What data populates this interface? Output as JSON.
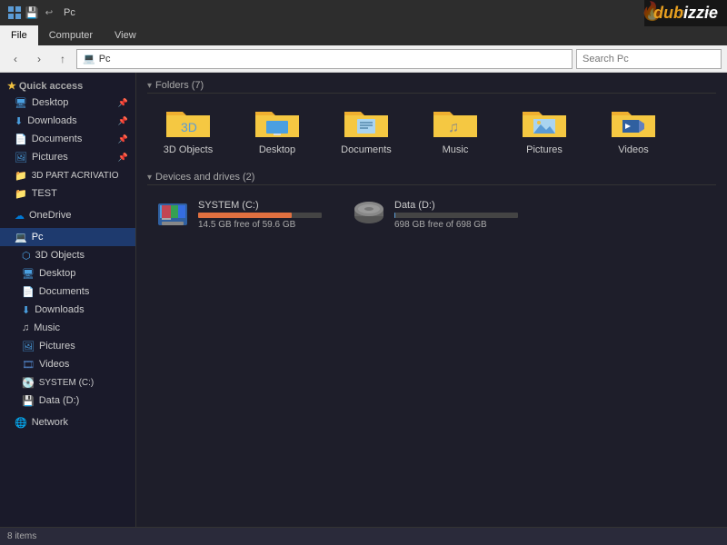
{
  "titlebar": {
    "title": "Pc",
    "minimize_label": "—",
    "maximize_label": "□",
    "close_label": "✕"
  },
  "ribbon": {
    "tabs": [
      "File",
      "Computer",
      "View"
    ],
    "active_tab": "File"
  },
  "address_bar": {
    "back_btn": "‹",
    "forward_btn": "›",
    "up_btn": "↑",
    "path_icon": "💻",
    "path": "Pc",
    "search_placeholder": "Search Pc"
  },
  "sidebar": {
    "quick_access_label": "Quick access",
    "items": [
      {
        "id": "desktop-qa",
        "label": "Desktop",
        "icon": "desktop",
        "pinned": true
      },
      {
        "id": "downloads-qa",
        "label": "Downloads",
        "icon": "download",
        "pinned": true
      },
      {
        "id": "documents-qa",
        "label": "Documents",
        "icon": "docs",
        "pinned": true
      },
      {
        "id": "pictures-qa",
        "label": "Pictures",
        "icon": "pics",
        "pinned": true
      },
      {
        "id": "3dpart",
        "label": "3D PART ACRIVATIO",
        "icon": "folder"
      },
      {
        "id": "test",
        "label": "TEST",
        "icon": "folder"
      },
      {
        "id": "onedrive",
        "label": "OneDrive",
        "icon": "onedrive"
      },
      {
        "id": "pc",
        "label": "Pc",
        "icon": "pc",
        "active": true
      },
      {
        "id": "3dobjects-pc",
        "label": "3D Objects",
        "icon": "folder",
        "indent": 1
      },
      {
        "id": "desktop-pc",
        "label": "Desktop",
        "icon": "desktop",
        "indent": 1
      },
      {
        "id": "documents-pc",
        "label": "Documents",
        "icon": "docs",
        "indent": 1
      },
      {
        "id": "downloads-pc",
        "label": "Downloads",
        "icon": "download",
        "indent": 1
      },
      {
        "id": "music-pc",
        "label": "Music",
        "icon": "music",
        "indent": 1
      },
      {
        "id": "pictures-pc",
        "label": "Pictures",
        "icon": "pics",
        "indent": 1
      },
      {
        "id": "videos-pc",
        "label": "Videos",
        "icon": "video",
        "indent": 1
      },
      {
        "id": "systemc",
        "label": "SYSTEM (C:)",
        "icon": "drive-c",
        "indent": 1
      },
      {
        "id": "datad",
        "label": "Data (D:)",
        "icon": "drive-d",
        "indent": 1
      },
      {
        "id": "network",
        "label": "Network",
        "icon": "network"
      }
    ]
  },
  "content": {
    "folders_header": "Folders (7)",
    "folders": [
      {
        "id": "3d",
        "label": "3D Objects",
        "type": "folder3d"
      },
      {
        "id": "desktop",
        "label": "Desktop",
        "type": "desktop"
      },
      {
        "id": "documents",
        "label": "Documents",
        "type": "documents"
      },
      {
        "id": "music",
        "label": "Music",
        "type": "music"
      },
      {
        "id": "pictures",
        "label": "Pictures",
        "type": "pictures"
      },
      {
        "id": "videos",
        "label": "Videos",
        "type": "videos"
      }
    ],
    "drives_header": "Devices and drives (2)",
    "drives": [
      {
        "id": "c",
        "label": "SYSTEM (C:)",
        "free_text": "14.5 GB free of 59.6 GB",
        "used_pct": 76,
        "low": true
      },
      {
        "id": "d",
        "label": "Data (D:)",
        "free_text": "698 GB free of 698 GB",
        "used_pct": 1,
        "low": false
      }
    ]
  },
  "statusbar": {
    "items_count": "8 items"
  },
  "watermark": {
    "text1": "dub",
    "text2": "izzie"
  }
}
